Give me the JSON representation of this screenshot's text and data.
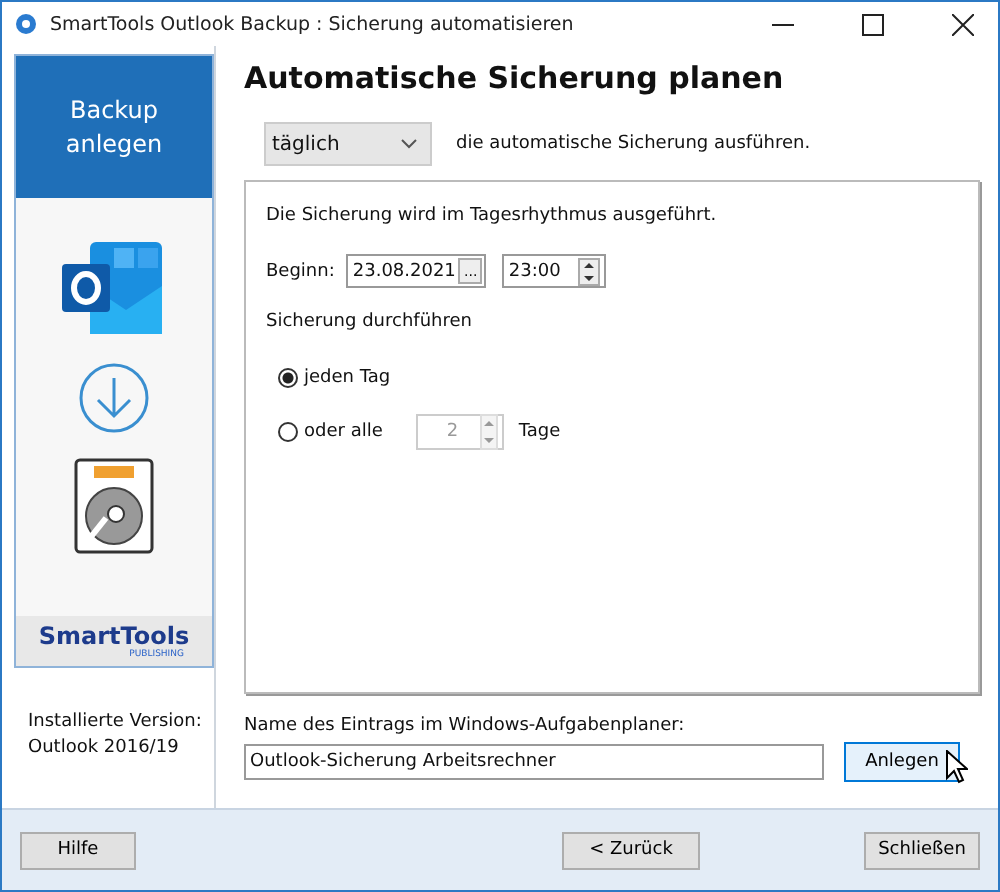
{
  "window": {
    "title": "SmartTools Outlook Backup : Sicherung automatisieren"
  },
  "sidebar": {
    "header": [
      "Backup",
      "anlegen"
    ],
    "logo": {
      "name": "SmartTools",
      "sub": "PUBLISHING"
    },
    "version": [
      "Installierte Version:",
      "Outlook 2016/19"
    ]
  },
  "heading": "Automatische Sicherung planen",
  "frequency": {
    "value": "täglich",
    "suffix": "die automatische Sicherung ausführen."
  },
  "schedule": {
    "description": "Die Sicherung wird im Tagesrhythmus ausgeführt.",
    "start_label": "Beginn:",
    "date": "23.08.2021",
    "date_button": "...",
    "time": "23:00",
    "repeat_label": "Sicherung durchführen",
    "options": [
      {
        "kind": "plain",
        "label": "jeden Tag",
        "selected": true
      },
      {
        "kind": "interval",
        "label": "oder alle",
        "value": "2",
        "unit": "Tage",
        "selected": false
      }
    ]
  },
  "task": {
    "label": "Name des Eintrags im Windows-Aufgabenplaner:",
    "value": "Outlook-Sicherung Arbeitsrechner",
    "button": "Anlegen"
  },
  "buttons": [
    "Hilfe",
    "< Zurück",
    "Schließen"
  ]
}
